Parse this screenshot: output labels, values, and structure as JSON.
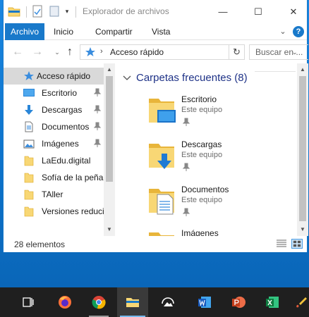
{
  "window": {
    "title": "Explorador de archivos",
    "quick_access_toolbar": [
      "folder-icon",
      "properties-icon",
      "new-folder-icon",
      "customize-dropdown-icon"
    ],
    "controls": {
      "minimize": "—",
      "maximize": "☐",
      "close": "✕"
    }
  },
  "ribbon": {
    "tabs": [
      {
        "label": "Archivo",
        "active": true
      },
      {
        "label": "Inicio"
      },
      {
        "label": "Compartir"
      },
      {
        "label": "Vista"
      }
    ],
    "expand_glyph": "⌄",
    "help_glyph": "?"
  },
  "address": {
    "back": "←",
    "forward": "→",
    "recent": "⌄",
    "up": "↑",
    "chevron": "›",
    "path": "Acceso rápido",
    "path_dropdown": "⌄",
    "refresh": "↻",
    "search_placeholder": "Buscar en ..."
  },
  "nav_pane": {
    "items": [
      {
        "label": "Acceso rápido",
        "icon": "star-icon",
        "selected": true
      },
      {
        "label": "Escritorio",
        "icon": "desktop-icon",
        "pinned": true
      },
      {
        "label": "Descargas",
        "icon": "download-icon",
        "pinned": true
      },
      {
        "label": "Documentos",
        "icon": "documents-icon",
        "pinned": true
      },
      {
        "label": "Imágenes",
        "icon": "pictures-icon",
        "pinned": true
      },
      {
        "label": "LaEdu.digital",
        "icon": "folder-icon"
      },
      {
        "label": "Sofía de la peña",
        "icon": "folder-icon"
      },
      {
        "label": "TAller",
        "icon": "folder-icon"
      },
      {
        "label": "Versiones reduci",
        "icon": "folder-icon"
      }
    ],
    "scroll_up": "▲",
    "scroll_down": "▼"
  },
  "content": {
    "group_title": "Carpetas frecuentes (8)",
    "tiles": [
      {
        "name": "Escritorio",
        "location": "Este equipo",
        "icon": "desktop-folder-icon"
      },
      {
        "name": "Descargas",
        "location": "Este equipo",
        "icon": "downloads-folder-icon"
      },
      {
        "name": "Documentos",
        "location": "Este equipo",
        "icon": "documents-folder-icon"
      },
      {
        "name": "Imágenes",
        "location": "",
        "icon": "pictures-folder-icon"
      }
    ],
    "scroll_up": "▲",
    "scroll_down": "▼"
  },
  "status": {
    "item_count": "28 elementos",
    "views": [
      "details-view-icon",
      "tiles-view-icon"
    ]
  },
  "taskbar": {
    "items": [
      "task-view-icon",
      "firefox-icon",
      "chrome-icon",
      "file-explorer-icon",
      "photos-icon",
      "word-icon",
      "powerpoint-icon",
      "excel-icon",
      "paint-icon"
    ],
    "active": "file-explorer-icon"
  },
  "colors": {
    "accent": "#1979ca",
    "desktop": "#0d72c9",
    "folder": "#f8d775",
    "taskbar": "#1f1f1f",
    "group_title": "#1e3287"
  }
}
